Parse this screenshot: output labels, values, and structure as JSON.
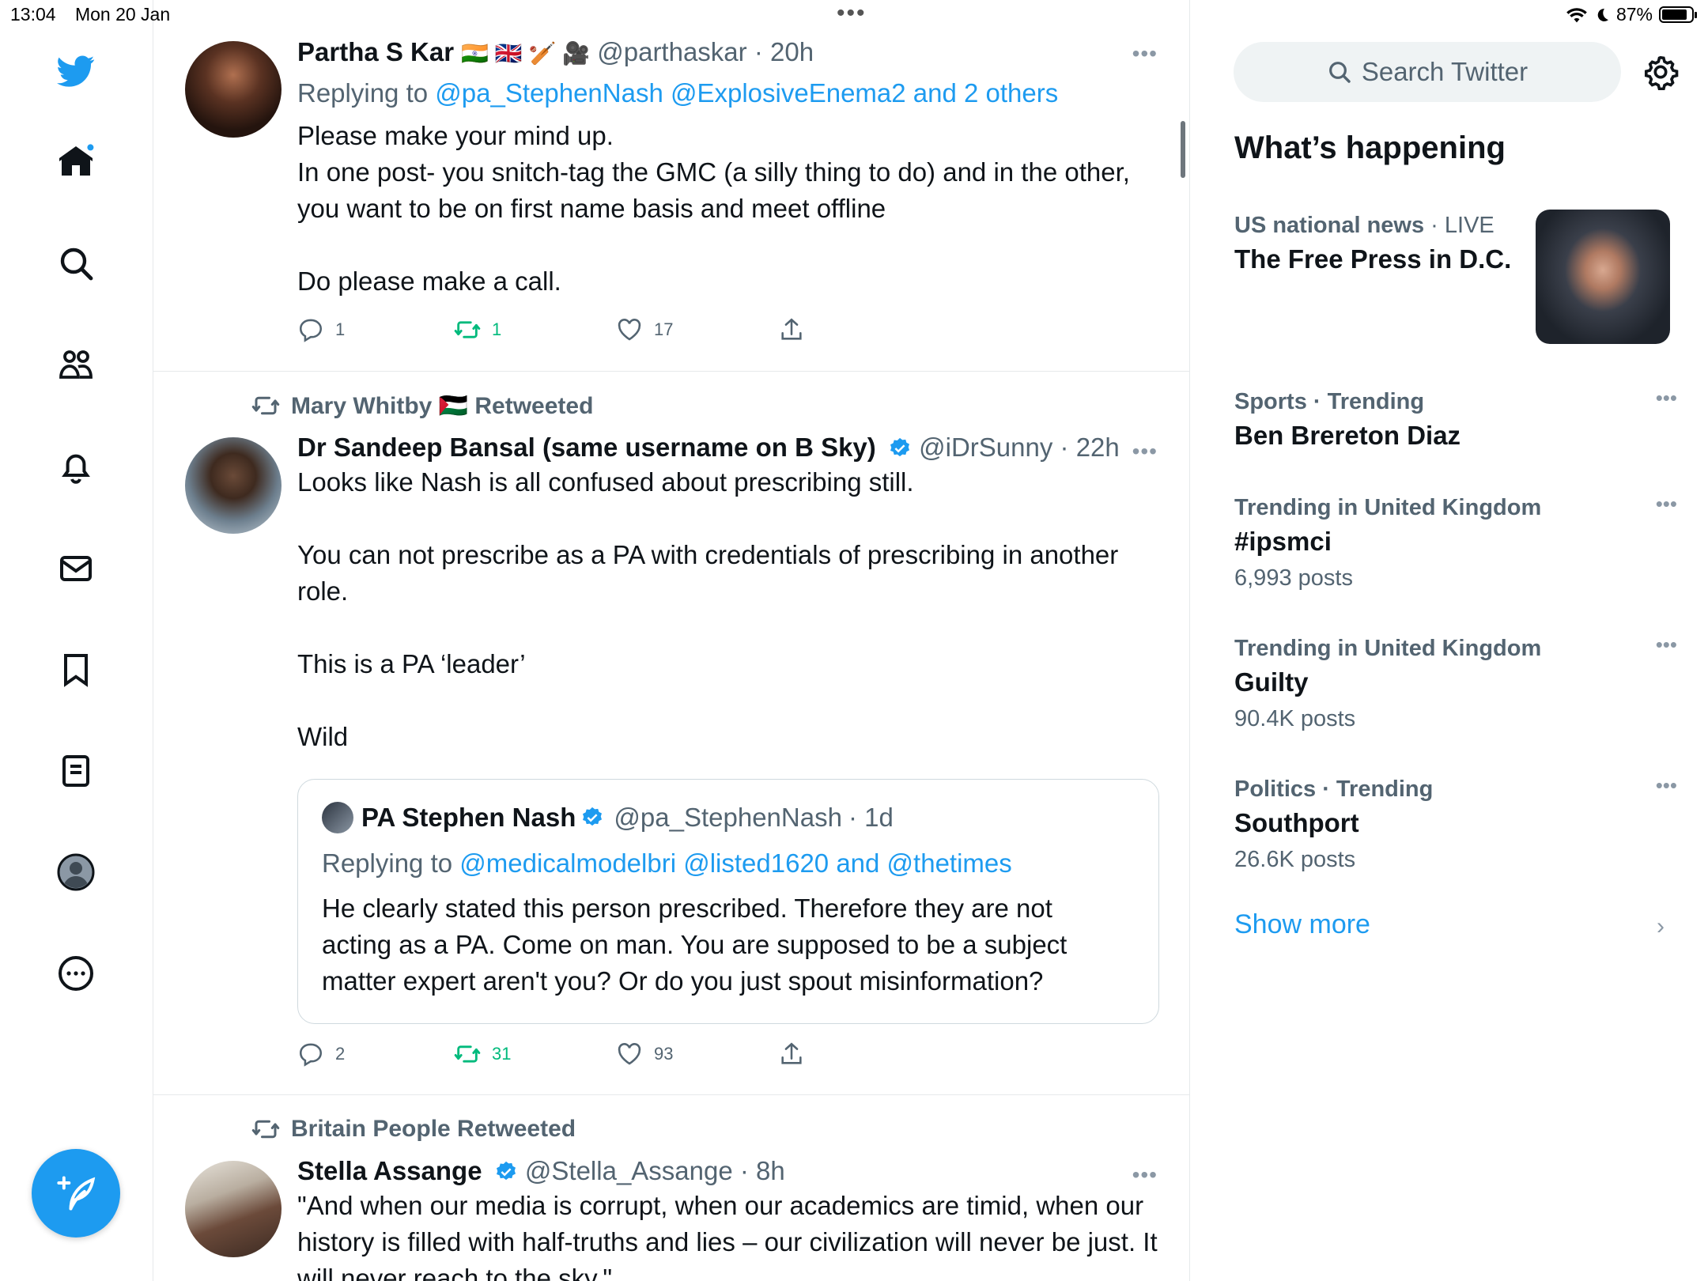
{
  "status_bar": {
    "time": "13:04",
    "date": "Mon 20 Jan",
    "battery": "87%",
    "battery_level": 0.87
  },
  "nav": {
    "icons": [
      "twitter-logo",
      "home-icon",
      "search-icon",
      "communities-icon",
      "notifications-icon",
      "messages-icon",
      "bookmarks-icon",
      "lists-icon",
      "profile-icon",
      "more-icon"
    ],
    "compose": "compose-icon"
  },
  "tweets": [
    {
      "name": "Partha S Kar",
      "flags": "🇮🇳 🇬🇧 🏏 🎥",
      "handle": "@parthaskar",
      "time": "· 20h",
      "reply_prefix": "Replying to ",
      "reply_links": "@pa_StephenNash @ExplosiveEnema2 and 2 others",
      "text": "Please make your mind up.\nIn one post- you snitch-tag the GMC (a silly thing to do) and in the other, you want to be on first name basis and meet offline\n\nDo please make a call.",
      "replies": "1",
      "retweets": "1",
      "likes": "17"
    },
    {
      "context": "Mary Whitby 🇵🇸 Retweeted",
      "name": "Dr Sandeep Bansal (same username on B Sky)",
      "handle": "@iDrSunny",
      "time": "· 22h",
      "text": "Looks like Nash is all confused about prescribing still.\n\nYou can not prescribe as a PA with credentials of prescribing in another role.\n\nThis is a PA ‘leader’\n\nWild",
      "quote": {
        "name": "PA Stephen Nash",
        "handle": "@pa_StephenNash",
        "time": "· 1d",
        "reply_prefix": "Replying to ",
        "reply_links": "@medicalmodelbri @listed1620 and @thetimes",
        "text": "He clearly stated this person prescribed. Therefore they are not acting as a PA. Come on man. You are  supposed to be a subject matter expert aren't you? Or do you just spout misinformation?"
      },
      "replies": "2",
      "retweets": "31",
      "likes": "93"
    },
    {
      "context": "Britain People Retweeted",
      "name": "Stella Assange",
      "handle": "@Stella_Assange",
      "time": "· 8h",
      "text": "\"And when our media is corrupt, when our academics are timid, when our history is filled with half-truths and lies – our civilization will never be just. It will never reach to the sky.\""
    }
  ],
  "sidebar": {
    "search_placeholder": "Search Twitter",
    "section_title": "What’s happening",
    "news": {
      "category": "US national news",
      "live": "· LIVE",
      "title": "The Free Press in D.C."
    },
    "trends": [
      {
        "meta": "Sports · Trending",
        "title": "Ben Brereton Diaz",
        "count": ""
      },
      {
        "meta": "Trending in United Kingdom",
        "title": "#ipsmci",
        "count": "6,993 posts"
      },
      {
        "meta": "Trending in United Kingdom",
        "title": "Guilty",
        "count": "90.4K posts"
      },
      {
        "meta": "Politics · Trending",
        "title": "Southport",
        "count": "26.6K posts"
      }
    ],
    "show_more": "Show more"
  },
  "colors": {
    "accent": "#1d9bf0",
    "retweet_green": "#00ba7c",
    "secondary_text": "#536471"
  }
}
